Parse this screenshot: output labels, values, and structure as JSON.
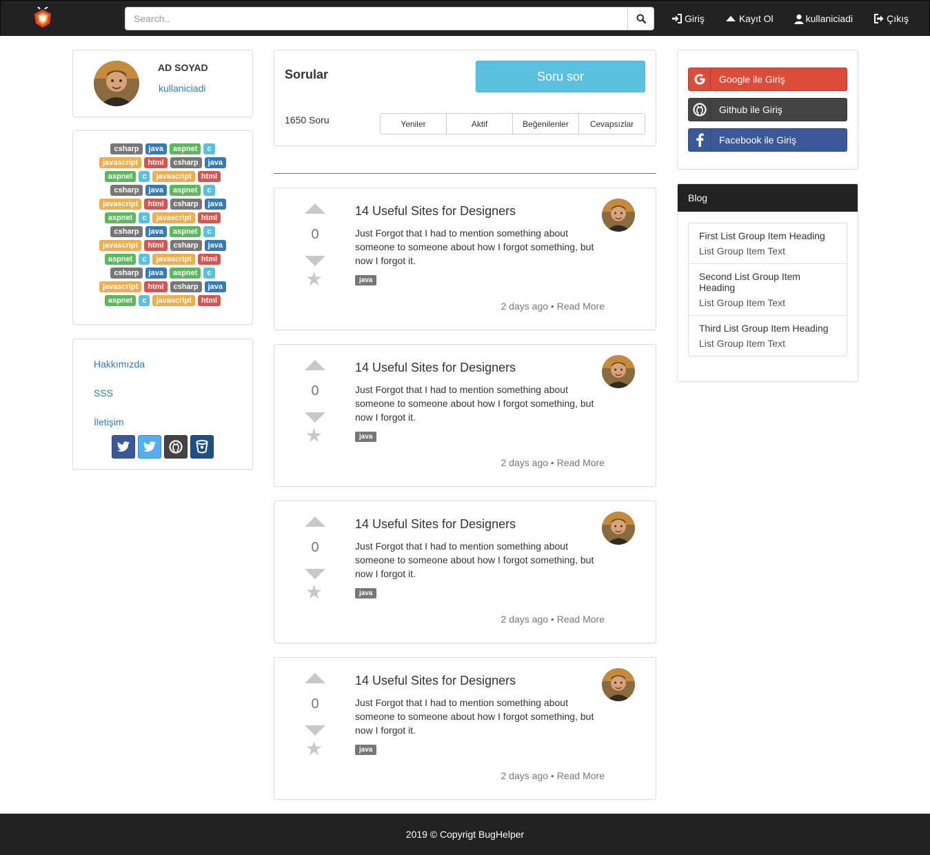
{
  "navbar": {
    "search_placeholder": "Search..",
    "links": [
      {
        "label": "Giriş",
        "icon": "log-in-icon"
      },
      {
        "label": "Kayıt Ol",
        "icon": "triangle-up-icon"
      },
      {
        "label": "kullaniciadi",
        "icon": "user-icon"
      },
      {
        "label": "Çıkış",
        "icon": "log-out-icon"
      }
    ]
  },
  "profile": {
    "name": "AD SOYAD",
    "username": "kullaniciadi"
  },
  "tags": [
    [
      "csharp",
      "java",
      "aspnet",
      "c"
    ],
    [
      "javascript",
      "html",
      "csharp",
      "java"
    ],
    [
      "aspnet",
      "c",
      "javascript",
      "html"
    ],
    [
      "csharp",
      "java",
      "aspnet",
      "c"
    ],
    [
      "javascript",
      "html",
      "csharp",
      "java"
    ],
    [
      "aspnet",
      "c",
      "javascript",
      "html"
    ],
    [
      "csharp",
      "java",
      "aspnet",
      "c"
    ],
    [
      "javascript",
      "html",
      "csharp",
      "java"
    ],
    [
      "aspnet",
      "c",
      "javascript",
      "html"
    ],
    [
      "csharp",
      "java",
      "aspnet",
      "c"
    ],
    [
      "javascript",
      "html",
      "csharp",
      "java"
    ],
    [
      "aspnet",
      "c",
      "javascript",
      "html"
    ]
  ],
  "side_links": {
    "about": "Hakkımızda",
    "faq": "SSS",
    "contact": "İletişim"
  },
  "questions_header": {
    "title": "Sorular",
    "ask_label": "Soru sor",
    "count_label": "1650 Soru",
    "filters": [
      "Yeniler",
      "Aktif",
      "Beğenilenler",
      "Cevapsızlar"
    ]
  },
  "questions": [
    {
      "votes": "0",
      "title": "14 Useful Sites for Designers",
      "text": "Just Forgot that I had to mention something about someone to someone about how I forgot something, but now I forgot it.",
      "tag": "java",
      "time": "2 days ago",
      "read_more": "Read More"
    },
    {
      "votes": "0",
      "title": "14 Useful Sites for Designers",
      "text": "Just Forgot that I had to mention something about someone to someone about how I forgot something, but now I forgot it.",
      "tag": "java",
      "time": "2 days ago",
      "read_more": "Read More"
    },
    {
      "votes": "0",
      "title": "14 Useful Sites for Designers",
      "text": "Just Forgot that I had to mention something about someone to someone about how I forgot something, but now I forgot it.",
      "tag": "java",
      "time": "2 days ago",
      "read_more": "Read More"
    },
    {
      "votes": "0",
      "title": "14 Useful Sites for Designers",
      "text": "Just Forgot that I had to mention something about someone to someone about how I forgot something, but now I forgot it.",
      "tag": "java",
      "time": "2 days ago",
      "read_more": "Read More"
    }
  ],
  "oauth": {
    "google": "Google ile Giriş",
    "github": "Github ile Giriş",
    "facebook": "Facebook ile Giriş"
  },
  "blog": {
    "title": "Blog",
    "items": [
      {
        "heading": "First List Group Item Heading",
        "text": "List Group Item Text"
      },
      {
        "heading": "Second List Group Item Heading",
        "text": "List Group Item Text"
      },
      {
        "heading": "Third List Group Item Heading",
        "text": "List Group Item Text"
      }
    ]
  },
  "footer": {
    "text": "2019 © Copyrigt BugHelper"
  },
  "colors": {
    "navbar": "#222222",
    "link": "#337ab7",
    "info": "#5bc0de",
    "google": "#dd4b39",
    "github": "#444444",
    "facebook": "#3b5998"
  }
}
